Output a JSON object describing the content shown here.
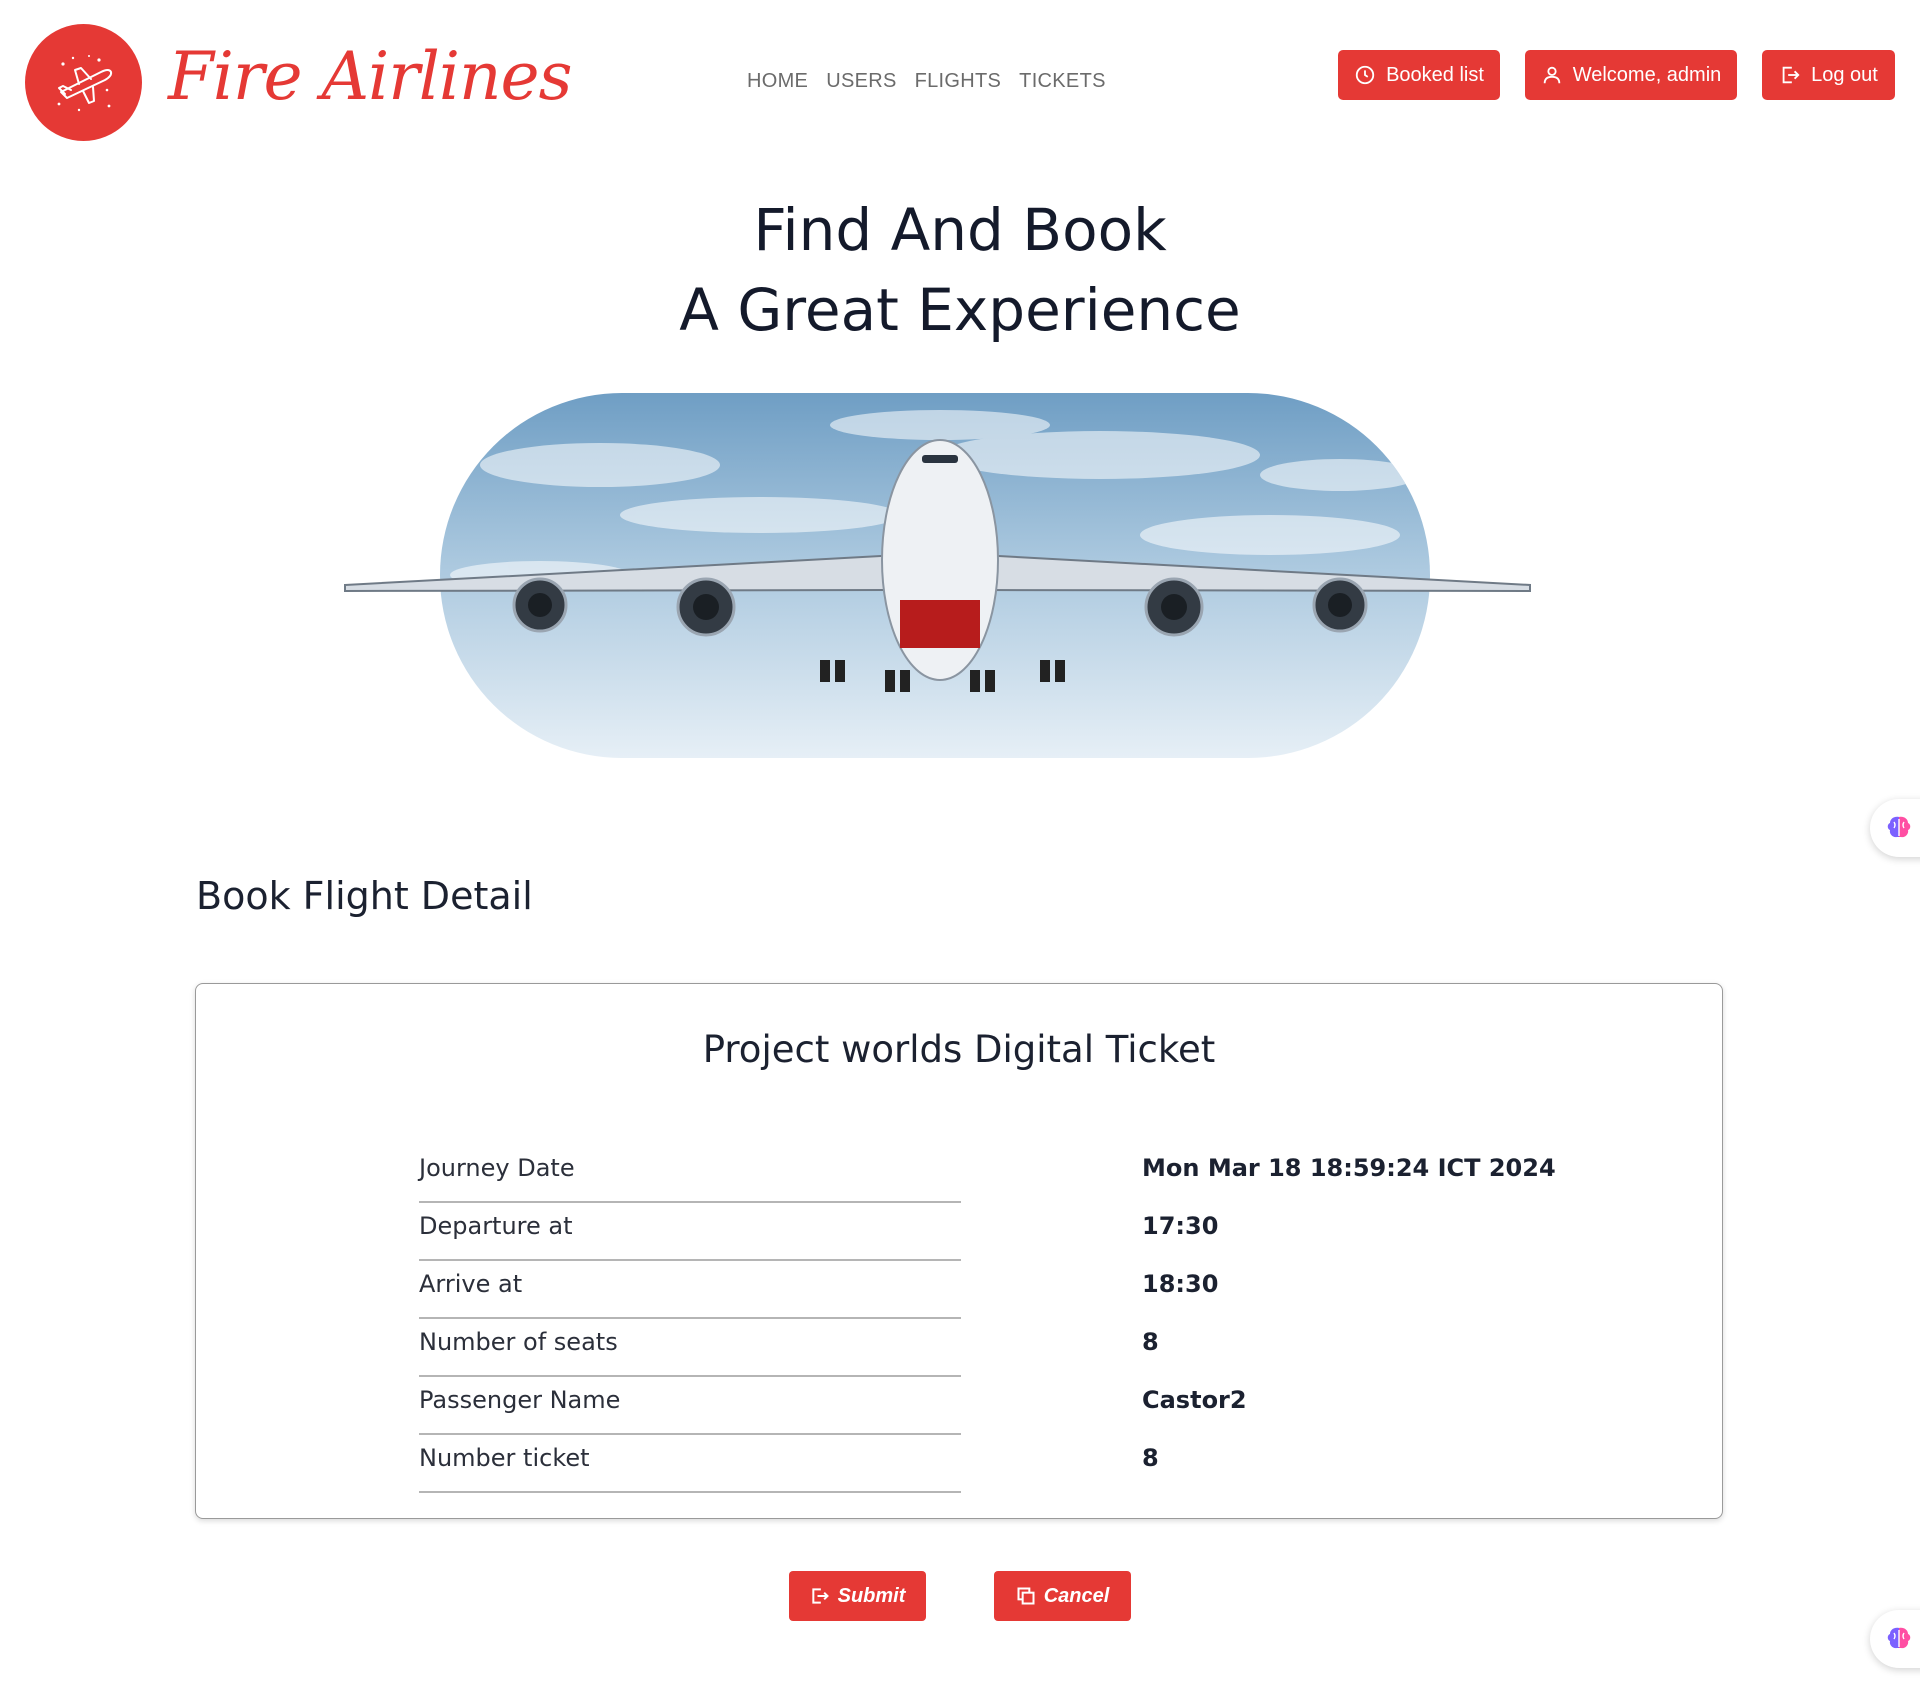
{
  "brand": {
    "name": "Fire Airlines",
    "color": "#e53935"
  },
  "nav": {
    "items": [
      {
        "label": "HOME"
      },
      {
        "label": "USERS"
      },
      {
        "label": "FLIGHTS"
      },
      {
        "label": "TICKETS"
      }
    ]
  },
  "header_buttons": {
    "booked_list": {
      "label": "Booked list",
      "icon": "clock-icon"
    },
    "welcome": {
      "label": "Welcome, admin",
      "icon": "user-icon"
    },
    "logout": {
      "label": "Log out",
      "icon": "logout-icon"
    }
  },
  "hero": {
    "line1": "Find And Book",
    "line2": "A Great Experience"
  },
  "section": {
    "title": "Book Flight Detail"
  },
  "ticket": {
    "title": "Project worlds Digital Ticket",
    "rows": [
      {
        "label": "Journey Date",
        "value": "Mon Mar 18 18:59:24 ICT 2024"
      },
      {
        "label": "Departure at",
        "value": "17:30"
      },
      {
        "label": "Arrive at",
        "value": "18:30"
      },
      {
        "label": "Number of seats",
        "value": "8"
      },
      {
        "label": "Passenger Name",
        "value": "Castor2"
      },
      {
        "label": "Number ticket",
        "value": "8"
      }
    ]
  },
  "actions": {
    "submit": {
      "label": "Submit",
      "icon": "submit-icon"
    },
    "cancel": {
      "label": "Cancel",
      "icon": "cancel-icon"
    }
  },
  "floating_widget": {
    "icon": "brain-icon"
  }
}
